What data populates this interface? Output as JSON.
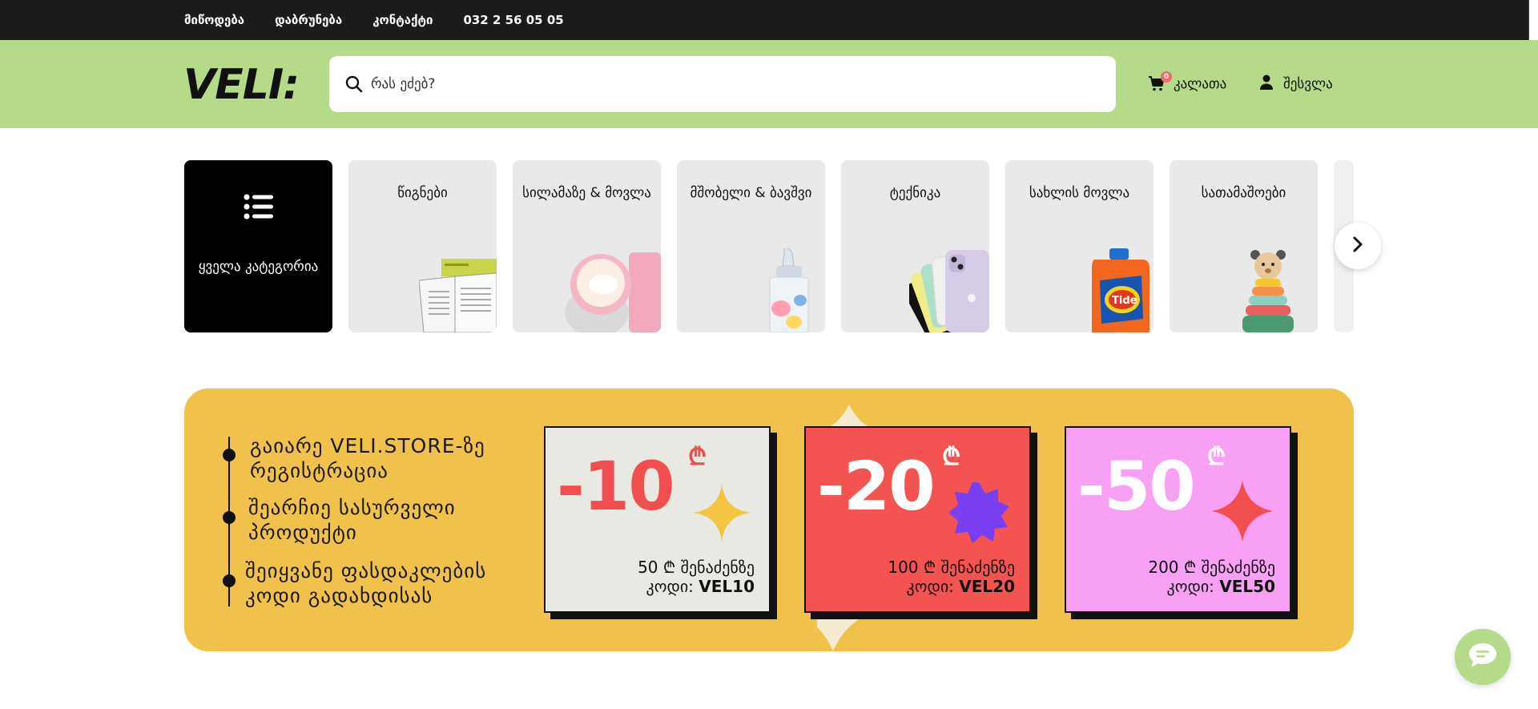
{
  "topbar": {
    "links": [
      "მიწოდება",
      "დაბრუნება",
      "კონტაქტი",
      "032 2 56 05 05"
    ]
  },
  "header": {
    "logo_text": "VELI:",
    "search_placeholder": "რას ეძებ?",
    "cart_label": "კალათა",
    "cart_count": "0",
    "login_label": "შესვლა",
    "accent_color": "#b5da8a"
  },
  "categories": {
    "items": [
      {
        "label": "ყველა კატეგორია",
        "icon": "list-icon"
      },
      {
        "label": "წიგნები",
        "icon": "book-image"
      },
      {
        "label": "სილამაზე & მოვლა",
        "icon": "cream-jar-image"
      },
      {
        "label": "მშობელი & ბავშვი",
        "icon": "baby-bottle-image"
      },
      {
        "label": "ტექნიკა",
        "icon": "phone-image"
      },
      {
        "label": "სახლის მოვლა",
        "icon": "detergent-image"
      },
      {
        "label": "სათამაშოები",
        "icon": "toy-image"
      },
      {
        "label": "",
        "icon": ""
      }
    ]
  },
  "banner": {
    "steps": [
      "გაიარე VELI.STORE-ზე რეგისტრაცია",
      "შეარჩიე სასურველი პროდუქტი",
      "შეიყვანე ფასდაკლების კოდი გადახდისას"
    ],
    "coupons": [
      {
        "discount": "-10",
        "currency": "₾",
        "min": "50 ₾ შენაძენზე",
        "code_label": "კოდი:",
        "code": "VEL10",
        "bg": "#e8e9e3",
        "text_color": "#f14f4f"
      },
      {
        "discount": "-20",
        "currency": "₾",
        "min": "100 ₾ შენაძენზე",
        "code_label": "კოდი:",
        "code": "VEL20",
        "bg": "#f45451",
        "text_color": "#ffffff"
      },
      {
        "discount": "-50",
        "currency": "₾",
        "min": "200 ₾ შენაძენზე",
        "code_label": "კოდი:",
        "code": "VEL50",
        "bg": "#f7a0f4",
        "text_color": "#ffffff"
      }
    ]
  }
}
